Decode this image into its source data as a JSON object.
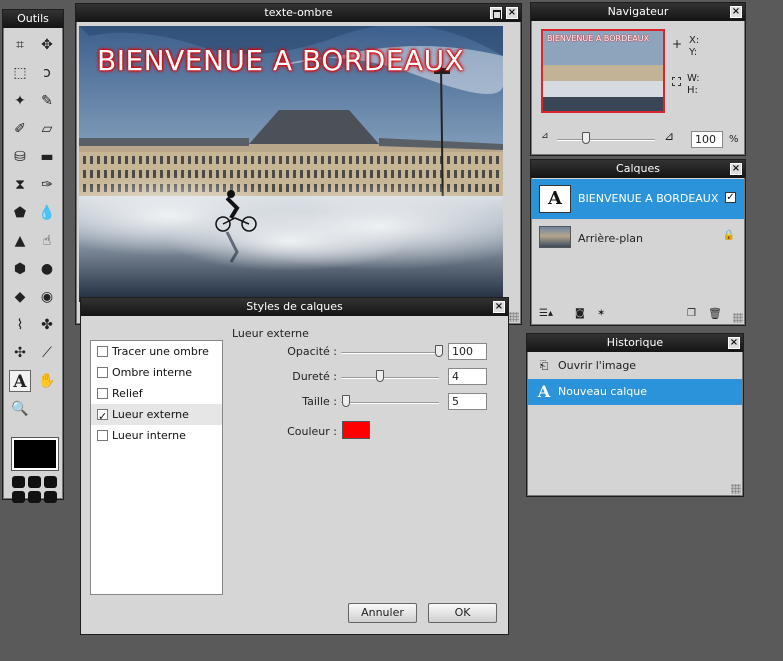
{
  "tools_panel": {
    "title": "Outils",
    "tools": [
      {
        "icon": "crop-icon",
        "glyph": "⌗"
      },
      {
        "icon": "move-icon",
        "glyph": "✥"
      },
      {
        "icon": "marquee-icon",
        "glyph": "⬚"
      },
      {
        "icon": "lasso-icon",
        "glyph": "ↄ"
      },
      {
        "icon": "magic-wand-icon",
        "glyph": "✦"
      },
      {
        "icon": "pencil-icon",
        "glyph": "✎"
      },
      {
        "icon": "brush-icon",
        "glyph": "✐"
      },
      {
        "icon": "eraser-icon",
        "glyph": "▱"
      },
      {
        "icon": "paint-bucket-icon",
        "glyph": "⛁"
      },
      {
        "icon": "gradient-icon",
        "glyph": "▬"
      },
      {
        "icon": "stamp-icon",
        "glyph": "⧗"
      },
      {
        "icon": "color-replace-icon",
        "glyph": "✑"
      },
      {
        "icon": "shape-icon",
        "glyph": "⬟"
      },
      {
        "icon": "drop-icon",
        "glyph": "💧"
      },
      {
        "icon": "sharpen-icon",
        "glyph": "▲"
      },
      {
        "icon": "smudge-icon",
        "glyph": "☝"
      },
      {
        "icon": "sponge-icon",
        "glyph": "⬢"
      },
      {
        "icon": "burn-icon",
        "glyph": "●"
      },
      {
        "icon": "dodge-icon",
        "glyph": "◆"
      },
      {
        "icon": "red-eye-icon",
        "glyph": "◉"
      },
      {
        "icon": "bandage-icon",
        "glyph": "⌇"
      },
      {
        "icon": "bloat-icon",
        "glyph": "✤"
      },
      {
        "icon": "pinch-icon",
        "glyph": "✣"
      },
      {
        "icon": "eyedropper-icon",
        "glyph": "⟋"
      },
      {
        "icon": "text-icon",
        "glyph": "A"
      },
      {
        "icon": "hand-icon",
        "glyph": "✋"
      },
      {
        "icon": "zoom-icon",
        "glyph": "🔍"
      }
    ],
    "foreground_color": "#000000"
  },
  "document": {
    "title": "texte-ombre",
    "banner_text": "BIENVENUE A BORDEAUX",
    "glow_color": "#e00000"
  },
  "navigator": {
    "title": "Navigateur",
    "x_label": "X:",
    "y_label": "Y:",
    "w_label": "W:",
    "h_label": "H:",
    "thumb_text": "BIENVENUE A BORDEAUX",
    "zoom_value": "100",
    "zoom_unit": "%",
    "zoom_level": 0.3
  },
  "layers": {
    "title": "Calques",
    "items": [
      {
        "name": "BIENVENUE A BORDEAUX",
        "selected": true
      },
      {
        "name": "Arrière-plan",
        "selected": false
      }
    ]
  },
  "history": {
    "title": "Historique",
    "items": [
      {
        "label": "Ouvrir l'image",
        "selected": false
      },
      {
        "label": "Nouveau calque",
        "selected": true
      }
    ]
  },
  "dialog": {
    "title": "Styles de calques",
    "styles": [
      {
        "label": "Tracer une ombre",
        "checked": false,
        "selected": false
      },
      {
        "label": "Ombre interne",
        "checked": false,
        "selected": false
      },
      {
        "label": "Relief",
        "checked": false,
        "selected": false
      },
      {
        "label": "Lueur externe",
        "checked": true,
        "selected": true
      },
      {
        "label": "Lueur interne",
        "checked": false,
        "selected": false
      }
    ],
    "section_title": "Lueur externe",
    "opacity_label": "Opacité :",
    "opacity_value": "100",
    "opacity_level": 1.0,
    "hardness_label": "Dureté :",
    "hardness_value": "4",
    "hardness_level": 0.4,
    "size_label": "Taille :",
    "size_value": "5",
    "size_level": 0.05,
    "color_label": "Couleur :",
    "glow_color": "#ff0000",
    "cancel_label": "Annuler",
    "ok_label": "OK"
  }
}
